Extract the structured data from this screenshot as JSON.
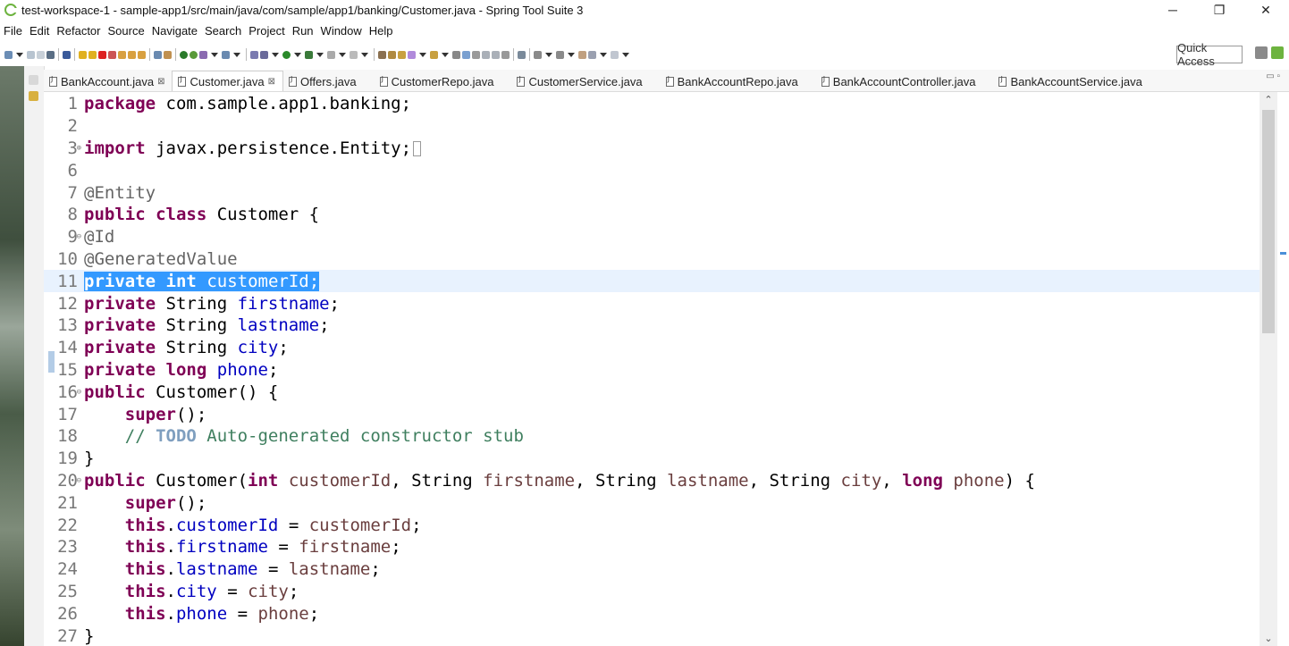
{
  "window": {
    "title": "test-workspace-1 - sample-app1/src/main/java/com/sample/app1/banking/Customer.java - Spring Tool Suite 3",
    "minimize": "─",
    "restore": "❐",
    "close": "✕"
  },
  "menu": [
    "File",
    "Edit",
    "Refactor",
    "Source",
    "Navigate",
    "Search",
    "Project",
    "Run",
    "Window",
    "Help"
  ],
  "toolbar": {
    "quick_access": "Quick Access"
  },
  "tabs": [
    {
      "label": "BankAccount.java",
      "close": "⊠",
      "active": false
    },
    {
      "label": "Customer.java",
      "close": "⊠",
      "active": true
    },
    {
      "label": "Offers.java",
      "active": false
    },
    {
      "label": "CustomerRepo.java",
      "active": false
    },
    {
      "label": "CustomerService.java",
      "active": false
    },
    {
      "label": "BankAccountRepo.java",
      "active": false
    },
    {
      "label": "BankAccountController.java",
      "active": false
    },
    {
      "label": "BankAccountService.java",
      "active": false
    }
  ],
  "editor": {
    "lines": [
      {
        "n": "1",
        "code": "package com.sample.app1.banking;"
      },
      {
        "n": "2",
        "code": ""
      },
      {
        "n": "3",
        "code": "import javax.persistence.Entity;"
      },
      {
        "n": "6",
        "code": ""
      },
      {
        "n": "7",
        "code": "@Entity"
      },
      {
        "n": "8",
        "code": "public class Customer {"
      },
      {
        "n": "9",
        "code": "@Id"
      },
      {
        "n": "10",
        "code": "@GeneratedValue"
      },
      {
        "n": "11",
        "code": "private int customerId;"
      },
      {
        "n": "12",
        "code": "private String firstname;"
      },
      {
        "n": "13",
        "code": "private String lastname;"
      },
      {
        "n": "14",
        "code": "private String city;"
      },
      {
        "n": "15",
        "code": "private long phone;"
      },
      {
        "n": "16",
        "code": "public Customer() {"
      },
      {
        "n": "17",
        "code": "    super();"
      },
      {
        "n": "18",
        "code": "    // TODO Auto-generated constructor stub"
      },
      {
        "n": "19",
        "code": "}"
      },
      {
        "n": "20",
        "code": "public Customer(int customerId, String firstname, String lastname, String city, long phone) {"
      },
      {
        "n": "21",
        "code": "    super();"
      },
      {
        "n": "22",
        "code": "    this.customerId = customerId;"
      },
      {
        "n": "23",
        "code": "    this.firstname = firstname;"
      },
      {
        "n": "24",
        "code": "    this.lastname = lastname;"
      },
      {
        "n": "25",
        "code": "    this.city = city;"
      },
      {
        "n": "26",
        "code": "    this.phone = phone;"
      },
      {
        "n": "27",
        "code": "}"
      }
    ],
    "selected_line": "11"
  }
}
